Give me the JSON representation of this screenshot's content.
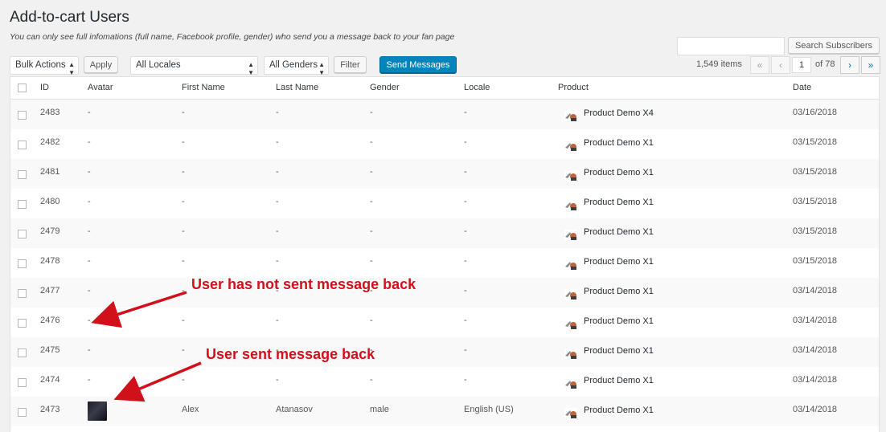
{
  "page": {
    "title": "Add-to-cart Users",
    "subtitle": "You can only see full infomations (full name, Facebook profile, gender) who send you a message back to your fan page"
  },
  "search": {
    "button_label": "Search Subscribers",
    "value": ""
  },
  "toolbar": {
    "bulk_actions": "Bulk Actions",
    "apply": "Apply",
    "locales": "All Locales",
    "genders": "All Genders",
    "filter": "Filter",
    "send_messages": "Send Messages"
  },
  "pagination": {
    "items": "1,549 items",
    "first": "«",
    "prev": "‹",
    "current_page": "1",
    "of": "of 78",
    "next": "›",
    "last": "»"
  },
  "columns": [
    "ID",
    "Avatar",
    "First Name",
    "Last Name",
    "Gender",
    "Locale",
    "Product",
    "Date"
  ],
  "rows": [
    {
      "id": "2483",
      "avatar": "-",
      "first": "-",
      "last": "-",
      "gender": "-",
      "locale": "-",
      "product": "Product Demo X4",
      "date": "03/16/2018"
    },
    {
      "id": "2482",
      "avatar": "-",
      "first": "-",
      "last": "-",
      "gender": "-",
      "locale": "-",
      "product": "Product Demo X1",
      "date": "03/15/2018"
    },
    {
      "id": "2481",
      "avatar": "-",
      "first": "-",
      "last": "-",
      "gender": "-",
      "locale": "-",
      "product": "Product Demo X1",
      "date": "03/15/2018"
    },
    {
      "id": "2480",
      "avatar": "-",
      "first": "-",
      "last": "-",
      "gender": "-",
      "locale": "-",
      "product": "Product Demo X1",
      "date": "03/15/2018"
    },
    {
      "id": "2479",
      "avatar": "-",
      "first": "-",
      "last": "-",
      "gender": "-",
      "locale": "-",
      "product": "Product Demo X1",
      "date": "03/15/2018"
    },
    {
      "id": "2478",
      "avatar": "-",
      "first": "-",
      "last": "-",
      "gender": "-",
      "locale": "-",
      "product": "Product Demo X1",
      "date": "03/15/2018"
    },
    {
      "id": "2477",
      "avatar": "-",
      "first": "-",
      "last": "-",
      "gender": "-",
      "locale": "-",
      "product": "Product Demo X1",
      "date": "03/14/2018"
    },
    {
      "id": "2476",
      "avatar": "-",
      "first": "-",
      "last": "-",
      "gender": "-",
      "locale": "-",
      "product": "Product Demo X1",
      "date": "03/14/2018"
    },
    {
      "id": "2475",
      "avatar": "-",
      "first": "-",
      "last": "-",
      "gender": "-",
      "locale": "-",
      "product": "Product Demo X1",
      "date": "03/14/2018"
    },
    {
      "id": "2474",
      "avatar": "-",
      "first": "-",
      "last": "-",
      "gender": "-",
      "locale": "-",
      "product": "Product Demo X1",
      "date": "03/14/2018"
    },
    {
      "id": "2473",
      "avatar": "image",
      "first": "Alex",
      "last": "Atanasov",
      "gender": "male",
      "locale": "English (US)",
      "product": "Product Demo X1",
      "date": "03/14/2018"
    }
  ],
  "annotations": {
    "not_sent": "User has not sent message back",
    "sent": "User sent message back",
    "color": "#d0111b"
  },
  "colors": {
    "primary_button": "#0085ba",
    "accent_link": "#0073aa"
  }
}
